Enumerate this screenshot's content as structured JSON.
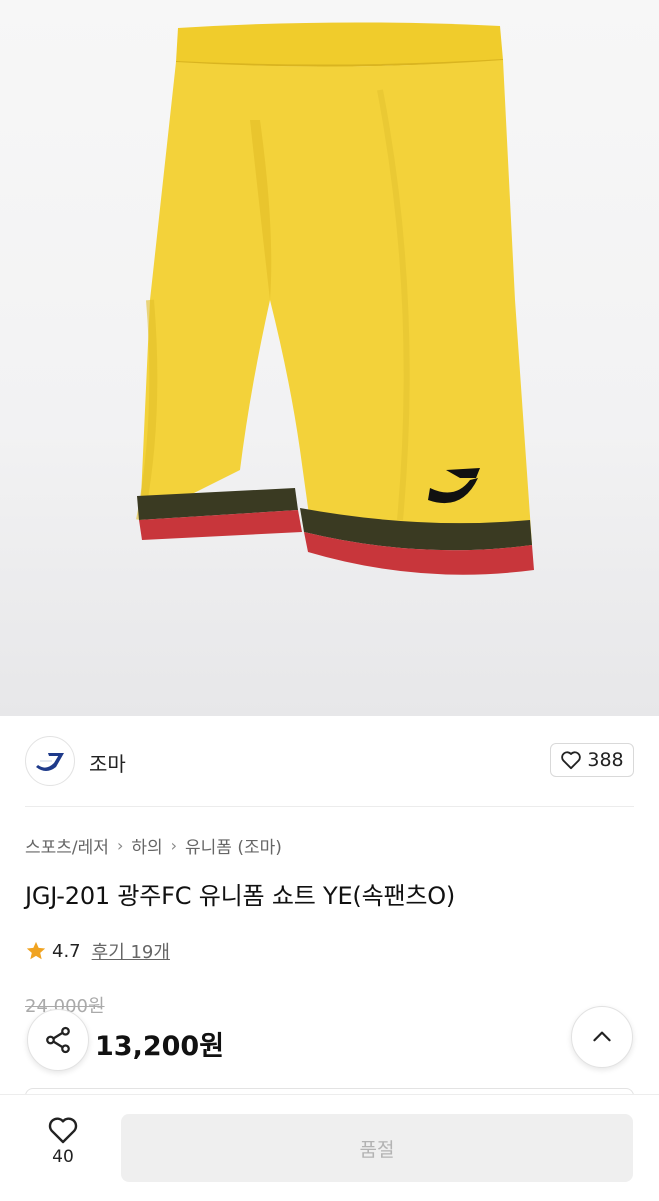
{
  "brand": {
    "name": "조마",
    "like_count": "388",
    "logo_icon": "joma-logo-icon"
  },
  "breadcrumb": [
    "스포츠/레저",
    "하의",
    "유니폼 (조마)"
  ],
  "product": {
    "title": "JGJ-201 광주FC 유니폼 쇼트 YE(속팬츠O)",
    "rating": "4.7",
    "review_link": "후기 19개",
    "original_price": "24,000원",
    "sale_price": "13,200원"
  },
  "bottom_bar": {
    "wish_count": "40",
    "soldout_label": "품절"
  },
  "colors": {
    "shorts_yellow": "#f3d23a",
    "band_dark": "#3a3a22",
    "band_red": "#c8363b",
    "star": "#f0a321",
    "logo_blue": "#1e3a8a"
  },
  "icons": [
    "heart-icon",
    "star-icon",
    "share-icon",
    "chevron-up-icon",
    "chevron-right-icon"
  ]
}
